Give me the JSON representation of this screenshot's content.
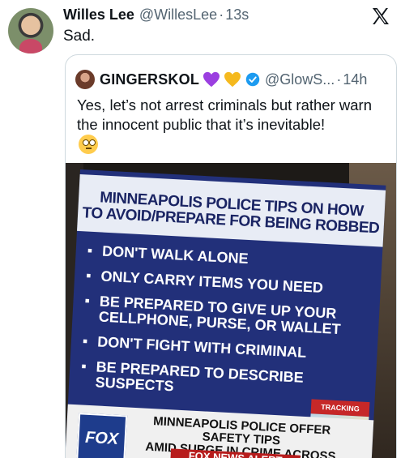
{
  "post": {
    "author_name": "Willes Lee",
    "author_handle": "@WillesLee",
    "time": "13s",
    "text": "Sad."
  },
  "quote": {
    "author_name": "GINGERSKOL",
    "author_handle": "@GlowS...",
    "time": "14h",
    "text": "Yes, let’s not arrest criminals but rather warn the innocent public that it’s inevitable!"
  },
  "media": {
    "title_line1": "MINNEAPOLIS POLICE TIPS ON HOW",
    "title_line2": "TO AVOID/PREPARE FOR BEING ROBBED",
    "bullets": [
      "DON'T WALK ALONE",
      "ONLY CARRY ITEMS YOU NEED",
      "BE PREPARED TO GIVE UP YOUR CELLPHONE, PURSE, OR WALLET",
      "DON'T FIGHT WITH CRIMINAL",
      "BE PREPARED TO DESCRIBE SUSPECTS"
    ],
    "ticker_line1": "MINNEAPOLIS POLICE OFFER SAFETY TIPS",
    "ticker_line2": "AMID SURGE IN CRIME ACROSS CITY",
    "alert": "FOX NEWS ALERT",
    "network": "FOX",
    "tracking": "TRACKING"
  },
  "icons": {
    "brand": "x-logo-icon",
    "verified_color": "#1d9bf0",
    "heart_purple": "#9b3fe0",
    "heart_yellow": "#f5b91e"
  }
}
